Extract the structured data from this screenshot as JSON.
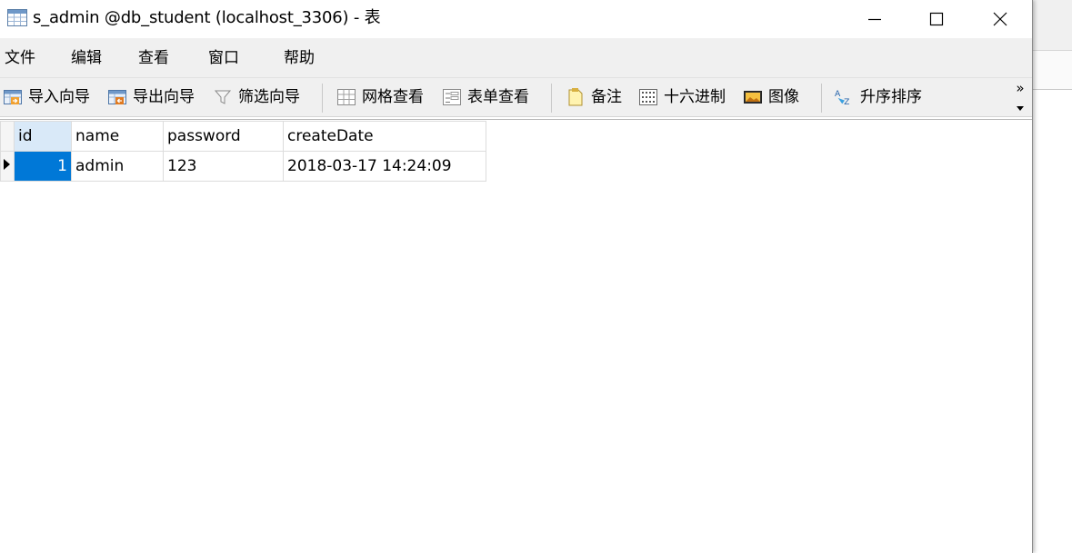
{
  "window": {
    "title": "s_admin @db_student (localhost_3306) - 表"
  },
  "menu": {
    "items": [
      "文件",
      "编辑",
      "查看",
      "窗口",
      "帮助"
    ]
  },
  "toolbar": {
    "import_wizard": "导入向导",
    "export_wizard": "导出向导",
    "filter_wizard": "筛选向导",
    "grid_view": "网格查看",
    "form_view": "表单查看",
    "memo": "备注",
    "hex": "十六进制",
    "image": "图像",
    "sort_asc": "升序排序",
    "more": "»"
  },
  "grid": {
    "columns": [
      "id",
      "name",
      "password",
      "createDate"
    ],
    "rows": [
      [
        "1",
        "admin",
        "123",
        "2018-03-17 14:24:09"
      ]
    ]
  }
}
